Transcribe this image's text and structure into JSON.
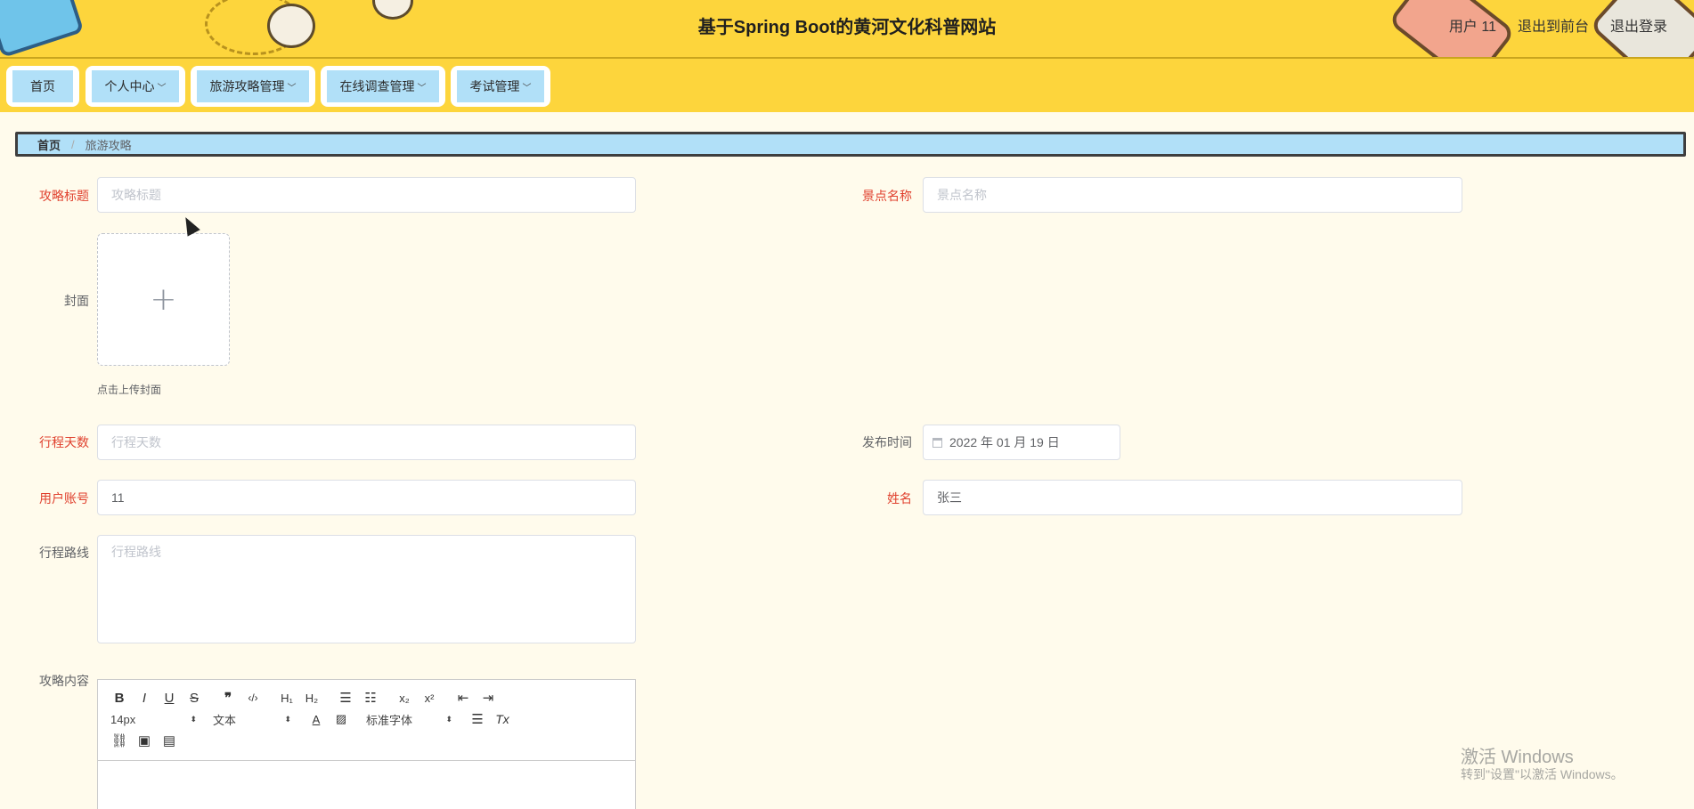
{
  "header": {
    "title": "基于Spring Boot的黄河文化科普网站",
    "user_label": "用户 11",
    "to_front_label": "退出到前台",
    "logout_label": "退出登录"
  },
  "nav": {
    "items": [
      {
        "label": "首页",
        "has_dropdown": false
      },
      {
        "label": "个人中心",
        "has_dropdown": true
      },
      {
        "label": "旅游攻略管理",
        "has_dropdown": true
      },
      {
        "label": "在线调查管理",
        "has_dropdown": true
      },
      {
        "label": "考试管理",
        "has_dropdown": true
      }
    ]
  },
  "breadcrumb": {
    "home": "首页",
    "separator": "/",
    "current": "旅游攻略"
  },
  "form": {
    "title": {
      "label": "攻略标题",
      "placeholder": "攻略标题",
      "value": ""
    },
    "spot": {
      "label": "景点名称",
      "placeholder": "景点名称",
      "value": ""
    },
    "cover": {
      "label": "封面",
      "tip": "点击上传封面",
      "plus": "+"
    },
    "days": {
      "label": "行程天数",
      "placeholder": "行程天数",
      "value": ""
    },
    "publish_time": {
      "label": "发布时间",
      "value": "2022 年 01 月 19 日"
    },
    "account": {
      "label": "用户账号",
      "value": "11"
    },
    "name": {
      "label": "姓名",
      "value": "张三"
    },
    "route": {
      "label": "行程路线",
      "placeholder": "行程路线"
    },
    "content": {
      "label": "攻略内容"
    }
  },
  "editor": {
    "font_size": "14px",
    "block_type": "文本",
    "font_family": "标准字体"
  },
  "watermark": {
    "line1": "激活 Windows",
    "line2": "转到\"设置\"以激活 Windows。"
  },
  "colors": {
    "header_bg": "#fdd53c",
    "nav_button_bg": "#b1e0f8",
    "page_bg": "#fffbec",
    "required_label": "#e0412e"
  }
}
